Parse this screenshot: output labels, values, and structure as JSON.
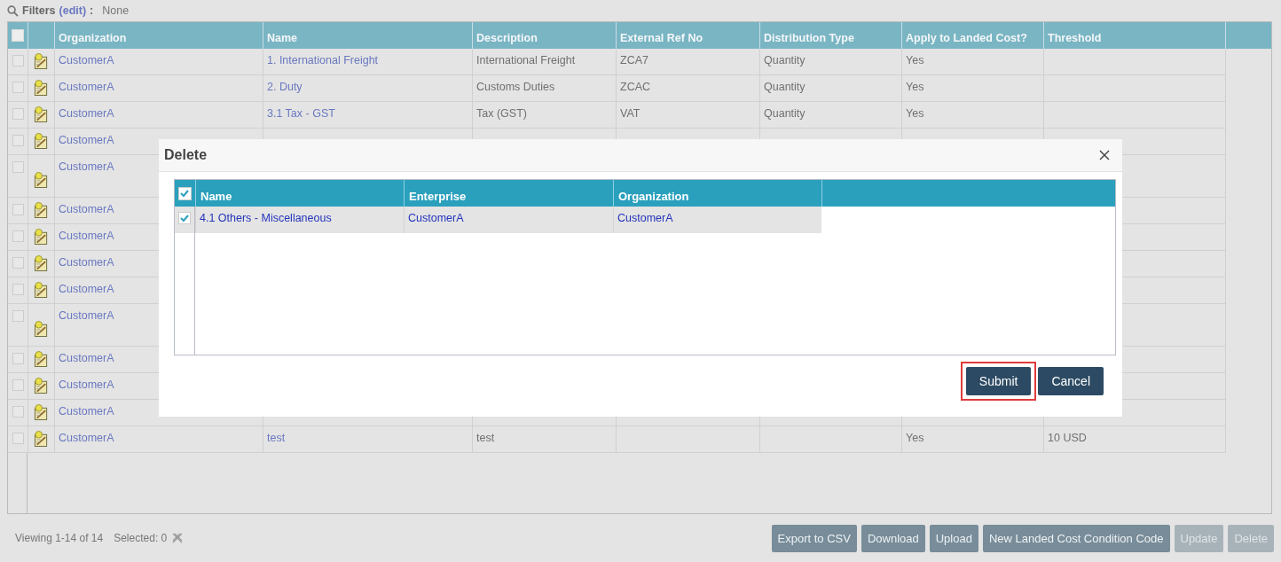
{
  "filters": {
    "label": "Filters",
    "link": "(edit)",
    "suffix": ":",
    "value": "None"
  },
  "table": {
    "header_checkbox": {
      "checked": false
    },
    "columns": [
      "Organization",
      "Name",
      "Description",
      "External Ref No",
      "Distribution Type",
      "Apply to Landed Cost?",
      "Threshold"
    ],
    "rows": [
      {
        "checked": false,
        "tall": false,
        "cells": [
          "CustomerA",
          "1. International Freight",
          "International Freight",
          "ZCA7",
          "Quantity",
          "Yes",
          null
        ]
      },
      {
        "checked": false,
        "tall": false,
        "cells": [
          "CustomerA",
          "2. Duty",
          "Customs Duties",
          "ZCAC",
          "Quantity",
          "Yes",
          null
        ]
      },
      {
        "checked": false,
        "tall": false,
        "cells": [
          "CustomerA",
          "3.1 Tax - GST",
          "Tax (GST)",
          "VAT",
          "Quantity",
          "Yes",
          null
        ]
      },
      {
        "checked": false,
        "tall": false,
        "cells": [
          "CustomerA",
          null,
          null,
          null,
          null,
          null,
          null
        ]
      },
      {
        "checked": false,
        "tall": true,
        "cells": [
          "CustomerA",
          null,
          null,
          null,
          null,
          null,
          null
        ]
      },
      {
        "checked": false,
        "tall": false,
        "cells": [
          "CustomerA",
          null,
          null,
          null,
          null,
          null,
          null
        ]
      },
      {
        "checked": false,
        "tall": false,
        "cells": [
          "CustomerA",
          null,
          null,
          null,
          null,
          null,
          null
        ]
      },
      {
        "checked": false,
        "tall": false,
        "cells": [
          "CustomerA",
          null,
          null,
          null,
          null,
          null,
          null
        ]
      },
      {
        "checked": false,
        "tall": false,
        "cells": [
          "CustomerA",
          null,
          null,
          null,
          null,
          null,
          null
        ]
      },
      {
        "checked": false,
        "tall": true,
        "cells": [
          "CustomerA",
          null,
          null,
          null,
          null,
          null,
          null
        ]
      },
      {
        "checked": false,
        "tall": false,
        "cells": [
          "CustomerA",
          null,
          null,
          null,
          null,
          null,
          null
        ]
      },
      {
        "checked": false,
        "tall": false,
        "cells": [
          "CustomerA",
          null,
          null,
          null,
          null,
          null,
          null
        ]
      },
      {
        "checked": false,
        "tall": false,
        "cells": [
          "CustomerA",
          null,
          null,
          null,
          null,
          null,
          null
        ]
      },
      {
        "checked": false,
        "tall": false,
        "cells": [
          "CustomerA",
          "test",
          "test",
          null,
          null,
          "Yes",
          "10 USD"
        ]
      }
    ]
  },
  "footer": {
    "viewing": "Viewing 1-14 of 14",
    "selected": "Selected: 0",
    "buttons": [
      {
        "label": "Export to CSV",
        "disabled": false
      },
      {
        "label": "Download",
        "disabled": false
      },
      {
        "label": "Upload",
        "disabled": false
      },
      {
        "label": "New Landed Cost Condition Code",
        "disabled": false
      },
      {
        "label": "Update",
        "disabled": true
      },
      {
        "label": "Delete",
        "disabled": true
      }
    ]
  },
  "dialog": {
    "title": "Delete",
    "header_checkbox": {
      "checked": true
    },
    "columns": [
      "Name",
      "Enterprise",
      "Organization"
    ],
    "rows": [
      {
        "checked": true,
        "cells": [
          "4.1 Others - Miscellaneous",
          "CustomerA",
          "CustomerA"
        ]
      }
    ],
    "buttons": [
      {
        "label": "Submit",
        "highlighted": true
      },
      {
        "label": "Cancel",
        "highlighted": false
      }
    ]
  }
}
